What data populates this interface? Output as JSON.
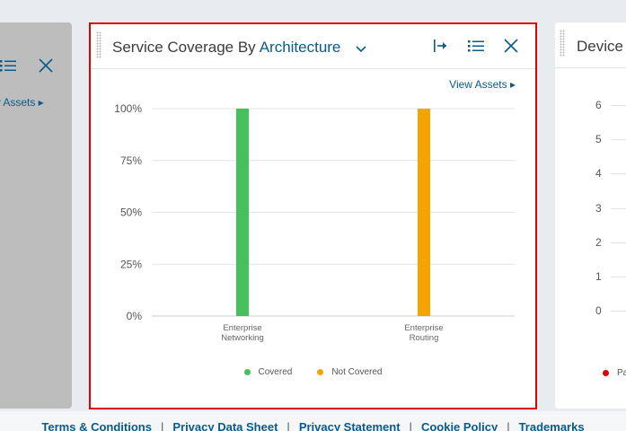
{
  "left_card": {
    "view_assets": "w Assets ▸",
    "list_icon": "list-icon",
    "close_icon": "close-icon"
  },
  "main_card": {
    "title_prefix": "Service Coverage By",
    "title_selector": "Architecture",
    "view_assets": "View Assets ▸",
    "icons": [
      "drag-handle-icon",
      "chevron-down-icon",
      "expand-icon",
      "list-icon",
      "close-icon"
    ]
  },
  "chart_data": {
    "type": "bar",
    "categories": [
      [
        "Enterprise",
        "Networking"
      ],
      [
        "Enterprise",
        "Routing"
      ]
    ],
    "series": [
      {
        "name": "Covered",
        "color": "#45c05a",
        "values": [
          100,
          0
        ]
      },
      {
        "name": "Not Covered",
        "color": "#f5a300",
        "values": [
          0,
          100
        ]
      }
    ],
    "y_ticks": [
      "0%",
      "25%",
      "50%",
      "75%",
      "100%"
    ],
    "ylim": [
      0,
      100
    ],
    "grid": true,
    "legend_placement": "bottom"
  },
  "right_card": {
    "title": "Device",
    "y_ticks": [
      "6",
      "5",
      "4",
      "3",
      "2",
      "1",
      "0"
    ],
    "legend_label": "Pa"
  },
  "footer": {
    "links": [
      "Terms & Conditions",
      "Privacy Data Sheet",
      "Privacy Statement",
      "Cookie Policy",
      "Trademarks"
    ],
    "separator": "|"
  },
  "colors": {
    "accent": "#0a5a8a",
    "highlight_border": "#e00000",
    "covered": "#45c05a",
    "not_covered": "#f5a300"
  }
}
